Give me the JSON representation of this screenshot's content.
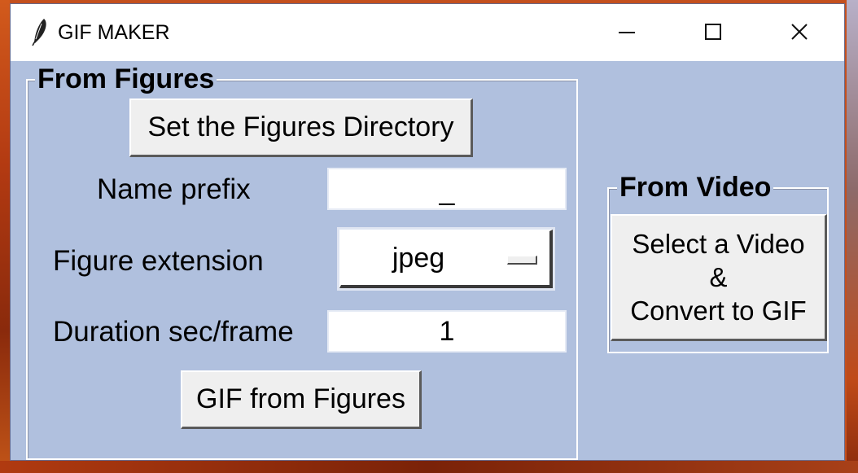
{
  "window": {
    "title": "GIF MAKER",
    "icon": "feather-icon",
    "controls": {
      "minimize": "minimize-icon",
      "maximize": "maximize-icon",
      "close": "close-icon"
    }
  },
  "figures": {
    "frame_title": "From Figures",
    "set_directory_label": "Set the Figures Directory",
    "name_prefix_label": "Name prefix",
    "name_prefix_value": "_",
    "extension_label": "Figure extension",
    "extension_value": "jpeg",
    "duration_label": "Duration sec/frame",
    "duration_value": "1",
    "gif_button_label": "GIF from Figures"
  },
  "video": {
    "frame_title": "From Video",
    "button_lines": [
      "Select a Video",
      "&",
      "Convert to GIF"
    ]
  },
  "colors": {
    "window_bg": "#b0c0de",
    "titlebar_bg": "#ffffff",
    "button_bg": "#efefef"
  }
}
